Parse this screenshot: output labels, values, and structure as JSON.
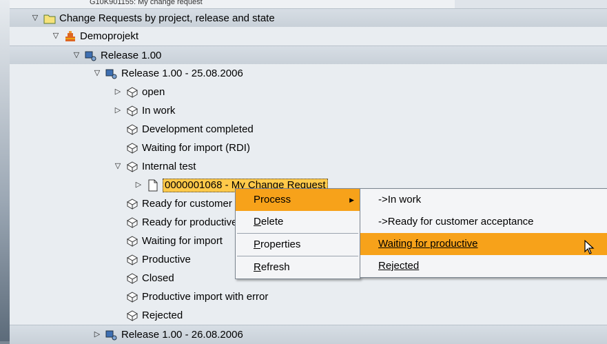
{
  "background": {
    "top_item_label": "G10K901155: My change request"
  },
  "tree": {
    "rows": [
      {
        "label": "Change Requests by project, release and state",
        "icon": "folder-icon",
        "expand": "expanded"
      },
      {
        "label": "Demoprojekt",
        "icon": "project-icon",
        "expand": "expanded"
      },
      {
        "label": "Release 1.00",
        "icon": "release-icon",
        "expand": "expanded"
      },
      {
        "label": "Release 1.00 - 25.08.2006",
        "icon": "release-icon",
        "expand": "expanded"
      },
      {
        "label": "open",
        "icon": "state-icon",
        "expand": "collapsed"
      },
      {
        "label": "In work",
        "icon": "state-icon",
        "expand": "collapsed"
      },
      {
        "label": "Development completed",
        "icon": "state-icon",
        "expand": "none"
      },
      {
        "label": "Waiting for import (RDI)",
        "icon": "state-icon",
        "expand": "none"
      },
      {
        "label": "Internal test",
        "icon": "state-icon",
        "expand": "expanded"
      },
      {
        "label": "0000001068 - My Change Request",
        "icon": "document-icon",
        "expand": "collapsed"
      },
      {
        "label": "Ready for customer acceptance",
        "icon": "state-icon",
        "expand": "none"
      },
      {
        "label": "Ready for productive",
        "icon": "state-icon",
        "expand": "none"
      },
      {
        "label": "Waiting for import",
        "icon": "state-icon",
        "expand": "none"
      },
      {
        "label": "Productive",
        "icon": "state-icon",
        "expand": "none"
      },
      {
        "label": "Closed",
        "icon": "state-icon",
        "expand": "none"
      },
      {
        "label": "Productive import with error",
        "icon": "state-icon",
        "expand": "none"
      },
      {
        "label": "Rejected",
        "icon": "state-icon",
        "expand": "none"
      },
      {
        "label": "Release 1.00 - 26.08.2006",
        "icon": "release-icon",
        "expand": "collapsed"
      }
    ]
  },
  "context_menu": {
    "items": [
      {
        "label": "Process",
        "mnemonic": "",
        "rest": "",
        "highlighted": true,
        "submenu": true
      },
      {
        "label": "Delete",
        "mnemonic": "D",
        "rest": "elete",
        "highlighted": false
      },
      {
        "label": "Properties",
        "mnemonic": "P",
        "rest": "roperties",
        "highlighted": false
      },
      {
        "label": "Refresh",
        "mnemonic": "R",
        "rest": "efresh",
        "highlighted": false
      }
    ]
  },
  "submenu": {
    "items": [
      {
        "label": "->In work",
        "highlighted": false
      },
      {
        "label": "->Ready for customer acceptance",
        "highlighted": false
      },
      {
        "label": "Waiting for productive",
        "highlighted": true
      },
      {
        "label": "Rejected",
        "highlighted": false
      }
    ]
  },
  "colors": {
    "highlight": "#f7a21a",
    "selection": "#ffc94a",
    "tree_background": "#e4e8ed"
  }
}
